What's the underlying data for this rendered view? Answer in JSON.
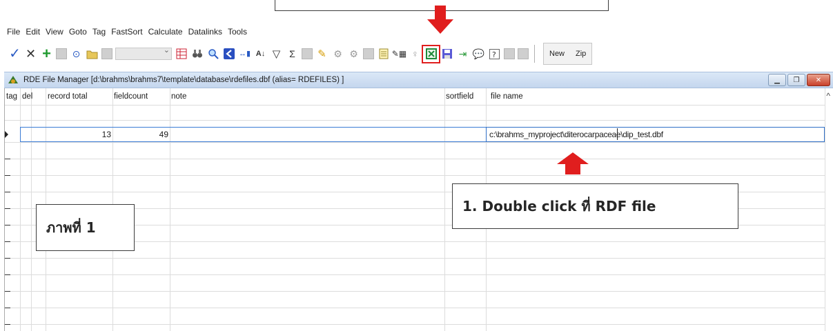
{
  "menu": [
    "File",
    "Edit",
    "View",
    "Goto",
    "Tag",
    "FastSort",
    "Calculate",
    "Datalinks",
    "Tools"
  ],
  "toolbar": {
    "new_label": "New",
    "zip_label": "Zip"
  },
  "window": {
    "title": "RDE File Manager [d:\\brahms\\brahms7\\template\\database\\rdefiles.dbf (alias= RDEFILES) ]"
  },
  "columns": {
    "tag": "tag",
    "del": "del",
    "record_total": "record total",
    "fieldcount": "fieldcount",
    "note": "note",
    "sortfield": "sortfield",
    "file_name": "file name"
  },
  "rows": [
    {
      "record_total": "13",
      "fieldcount": "49",
      "file_name": "c:\\brahms_myproject\\diterocarpaceae\\dip_test.dbf"
    }
  ],
  "callouts": {
    "step1": "1. Double click ที่ RDF file",
    "figure": "ภาพที่ 1"
  },
  "colors": {
    "arrow": "#e01e1e",
    "titlebar": "#c4d6ee",
    "selection_border": "#2f6fc6"
  }
}
